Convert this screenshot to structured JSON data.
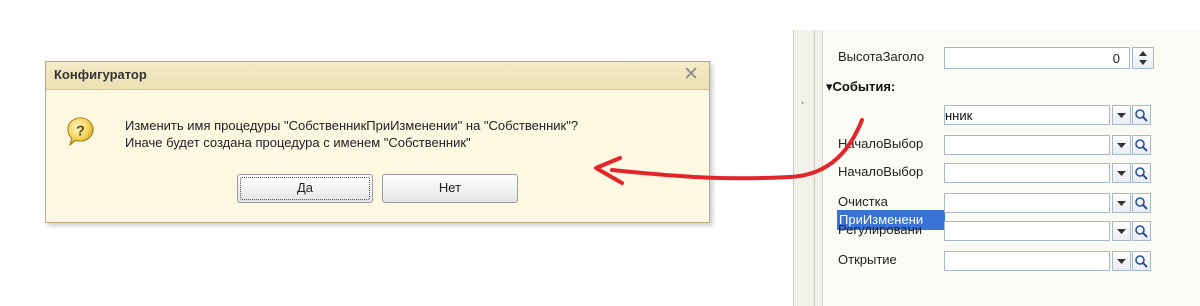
{
  "dialog": {
    "title": "Конфигуратор",
    "close_glyph": "✕",
    "message_line1": "Изменить имя процедуры \"СобственникПриИзменении\" на \"Собственник\"?",
    "message_line2": "Иначе будет создана процедура с именем \"Собственник\"",
    "yes_label": "Да",
    "no_label": "Нет",
    "icon": "question-icon"
  },
  "properties": {
    "header_height": {
      "label": "ВысотаЗаголо",
      "value": "0"
    },
    "events_section": "События:",
    "rows": [
      {
        "label": "ПриИзменени",
        "value": "нник",
        "selected": true
      },
      {
        "label": "НачалоВыбор",
        "value": ""
      },
      {
        "label": "НачалоВыбор",
        "value": ""
      },
      {
        "label": "Очистка",
        "value": ""
      },
      {
        "label": "Регулировани",
        "value": ""
      },
      {
        "label": "Открытие",
        "value": ""
      }
    ]
  },
  "colors": {
    "arrow": "#e3242b",
    "selection": "#3a73d6",
    "dialog_bg": "#fdf8e2"
  }
}
